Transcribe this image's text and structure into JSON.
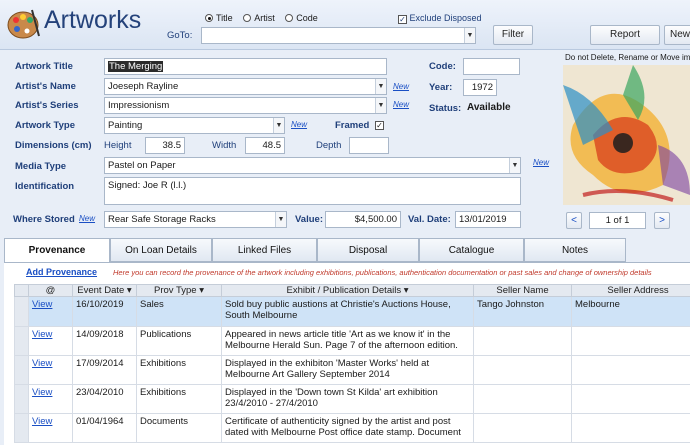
{
  "app": {
    "title": "Artworks"
  },
  "header": {
    "goto_label": "GoTo:",
    "goto_value": "",
    "radios": [
      {
        "label": "Title",
        "selected": true
      },
      {
        "label": "Artist",
        "selected": false
      },
      {
        "label": "Code",
        "selected": false
      }
    ],
    "exclude_disposed_label": "Exclude Disposed",
    "exclude_disposed_checked": true,
    "filter_label": "Filter",
    "report_label": "Report",
    "new_label": "New"
  },
  "form": {
    "artwork_title_label": "Artwork Title",
    "artwork_title_value": "The Merging",
    "artists_name_label": "Artist's Name",
    "artists_name_value": "Joeseph Rayline",
    "artists_series_label": "Artist's Series",
    "artists_series_value": "Impressionism",
    "artwork_type_label": "Artwork Type",
    "artwork_type_value": "Painting",
    "dimensions_label": "Dimensions (cm)",
    "height_label": "Height",
    "height_value": "38.5",
    "width_label": "Width",
    "width_value": "48.5",
    "depth_label": "Depth",
    "depth_value": "",
    "media_type_label": "Media Type",
    "media_type_value": "Pastel on Paper",
    "identification_label": "Identification",
    "identification_value": "Signed: Joe R (l.l.)",
    "where_stored_label": "Where Stored",
    "where_stored_value": "Rear Safe Storage Racks",
    "value_label": "Value:",
    "value_value": "$4,500.00",
    "val_date_label": "Val. Date:",
    "val_date_value": "13/01/2019",
    "code_label": "Code:",
    "code_value": "",
    "year_label": "Year:",
    "year_value": "1972",
    "status_label": "Status:",
    "status_value": "Available",
    "framed_label": "Framed",
    "framed_checked": true,
    "new_link": "New"
  },
  "image_panel": {
    "notice": "Do not Delete, Rename or Move images",
    "page_indicator": "1 of 1"
  },
  "tabs": [
    "Provenance",
    "On Loan Details",
    "Linked Files",
    "Disposal",
    "Catalogue",
    "Notes"
  ],
  "provenance": {
    "add_link": "Add Provenance",
    "hint": "Here you can record the provenance of the artwork including exhibitions, publications, authentication documentation or past sales and change of ownership details",
    "columns": [
      "@",
      "Event Date",
      "Prov Type",
      "Exhibit / Publication Details",
      "Seller Name",
      "Seller Address"
    ],
    "rows": [
      {
        "view": "View",
        "date": "16/10/2019",
        "type": "Sales",
        "details": "Sold buy public austions at Christie's Auctions House, South Melbourne",
        "seller": "Tango Johnston",
        "address": "Melbourne"
      },
      {
        "view": "View",
        "date": "14/09/2018",
        "type": "Publications",
        "details": "Appeared in news article title 'Art as we know it' in the Melbourne Herald Sun.  Page 7 of the afternoon edition.",
        "seller": "",
        "address": ""
      },
      {
        "view": "View",
        "date": "17/09/2014",
        "type": "Exhibitions",
        "details": "Displayed in the exhibiton 'Master Works' held at Melbourne Art Gallery September 2014",
        "seller": "",
        "address": ""
      },
      {
        "view": "View",
        "date": "23/04/2010",
        "type": "Exhibitions",
        "details": "Displayed in the 'Down town St Kilda' art exhibition 23/4/2010 - 27/4/2010",
        "seller": "",
        "address": ""
      },
      {
        "view": "View",
        "date": "01/04/1964",
        "type": "Documents",
        "details": "Certificate of authenticity signed by the artist and post dated with Melbourne Post office date stamp.  Document",
        "seller": "",
        "address": ""
      }
    ]
  },
  "colors": {
    "accent": "#1f3f7a",
    "selected_row": "#cfe3f7",
    "link": "#1a4fc4"
  }
}
